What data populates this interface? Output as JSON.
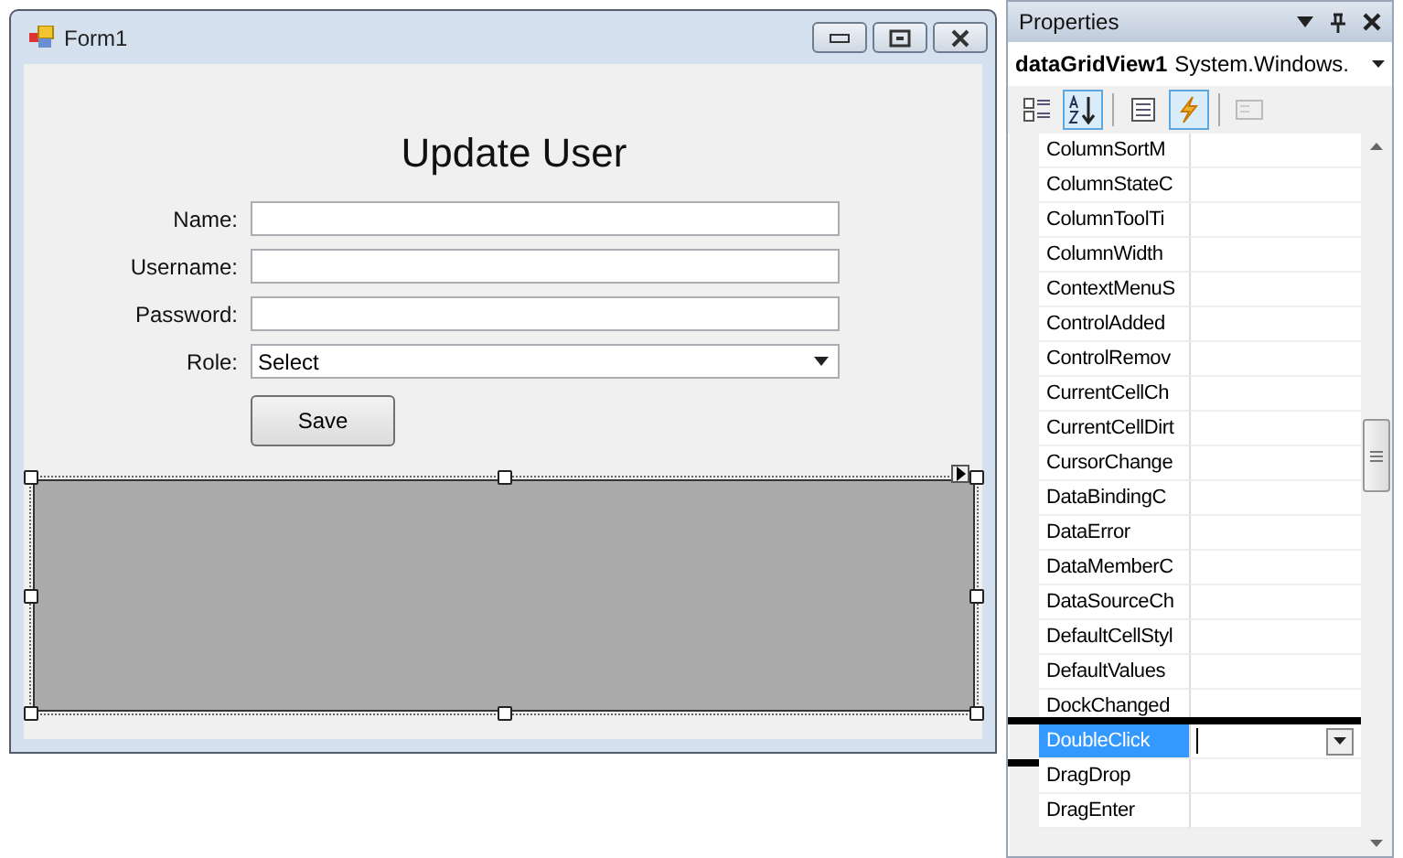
{
  "form": {
    "title": "Form1",
    "heading": "Update User",
    "fields": [
      {
        "label": "Name:",
        "kind": "text"
      },
      {
        "label": "Username:",
        "kind": "text"
      },
      {
        "label": "Password:",
        "kind": "text"
      },
      {
        "label": "Role:",
        "kind": "dropdown",
        "value": "Select"
      }
    ],
    "save_button": "Save"
  },
  "properties": {
    "title": "Properties",
    "object_name": "dataGridView1",
    "object_type": "System.Windows.",
    "toolbar": [
      {
        "kind": "categorized",
        "selected": false
      },
      {
        "kind": "alphabetical",
        "selected": true
      },
      {
        "kind": "properties",
        "selected": false
      },
      {
        "kind": "events",
        "selected": true
      },
      {
        "kind": "pages",
        "selected": false
      }
    ],
    "rows": [
      {
        "name": "ColumnSortM",
        "selected": false,
        "highlighted": false
      },
      {
        "name": "ColumnStateC",
        "selected": false,
        "highlighted": false
      },
      {
        "name": "ColumnToolTi",
        "selected": false,
        "highlighted": false
      },
      {
        "name": "ColumnWidth",
        "selected": false,
        "highlighted": false
      },
      {
        "name": "ContextMenuS",
        "selected": false,
        "highlighted": false
      },
      {
        "name": "ControlAdded",
        "selected": false,
        "highlighted": false
      },
      {
        "name": "ControlRemov",
        "selected": false,
        "highlighted": false
      },
      {
        "name": "CurrentCellCh",
        "selected": false,
        "highlighted": false
      },
      {
        "name": "CurrentCellDirt",
        "selected": false,
        "highlighted": false
      },
      {
        "name": "CursorChange",
        "selected": false,
        "highlighted": false
      },
      {
        "name": "DataBindingC",
        "selected": false,
        "highlighted": false
      },
      {
        "name": "DataError",
        "selected": false,
        "highlighted": false
      },
      {
        "name": "DataMemberC",
        "selected": false,
        "highlighted": false
      },
      {
        "name": "DataSourceCh",
        "selected": false,
        "highlighted": false
      },
      {
        "name": "DefaultCellStyl",
        "selected": false,
        "highlighted": false
      },
      {
        "name": "DefaultValues",
        "selected": false,
        "highlighted": false
      },
      {
        "name": "DockChanged",
        "selected": false,
        "highlighted": false
      },
      {
        "name": "DoubleClick",
        "selected": true,
        "highlighted": true
      },
      {
        "name": "DragDrop",
        "selected": false,
        "highlighted": false
      },
      {
        "name": "DragEnter",
        "selected": false,
        "highlighted": false
      }
    ]
  }
}
